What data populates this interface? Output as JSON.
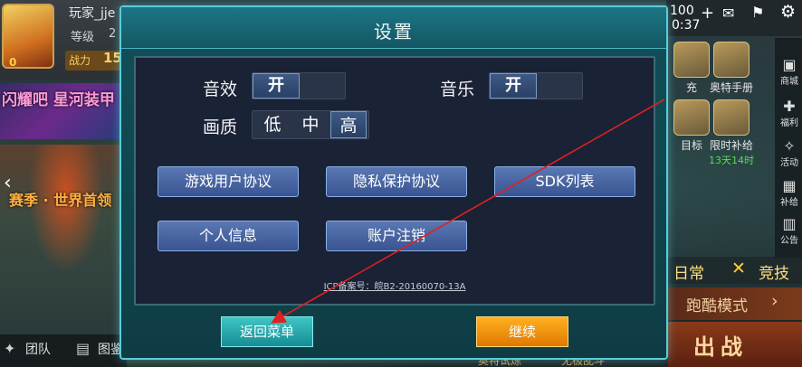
{
  "hud": {
    "player_name": "玩家_jje",
    "avatar_level": "0",
    "level_label": "等级",
    "level_value": "2",
    "power_label": "战力",
    "power_value": "15",
    "banner_text": "闪耀吧 星河装甲",
    "season_text": "赛季 · 世界首领",
    "team_label": "团队",
    "map_label": "图鉴",
    "status_number": "100",
    "status_time": "0:37",
    "right_menu": [
      {
        "label": "充",
        "sub": ""
      },
      {
        "label": "奥特手册",
        "sub": ""
      },
      {
        "label": "目标",
        "sub": ""
      },
      {
        "label": "限时补给",
        "sub": "13天14时"
      }
    ],
    "side_items": [
      "商城",
      "福利",
      "活动",
      "补给",
      "公告"
    ],
    "tab_daily": "日常",
    "tab_arena": "竞技",
    "parkour_label": "跑酷模式",
    "battle_label": "出战",
    "bottom_a": "奥特试炼",
    "bottom_b": "无极乱斗"
  },
  "dialog": {
    "title": "设置",
    "sound_label": "音效",
    "sound_value": "开",
    "music_label": "音乐",
    "music_value": "开",
    "quality_label": "画质",
    "quality_options": [
      "低",
      "中",
      "高"
    ],
    "quality_selected": "高",
    "buttons": {
      "user_agreement": "游戏用户协议",
      "privacy": "隐私保护协议",
      "sdk_list": "SDK列表",
      "personal_info": "个人信息",
      "account_cancel": "账户注销"
    },
    "icp": "ICP备案号：皖B2-20160070-13A",
    "back_label": "返回菜单",
    "continue_label": "继续"
  },
  "colors": {
    "dialog_border": "#5acdd8",
    "dialog_bg": "#12505a",
    "body_bg": "#1a2236",
    "primary_button": "#4a66a2",
    "back_button": "#2aa8ac",
    "continue_button": "#f09410",
    "annotation_arrow": "#e02020"
  }
}
